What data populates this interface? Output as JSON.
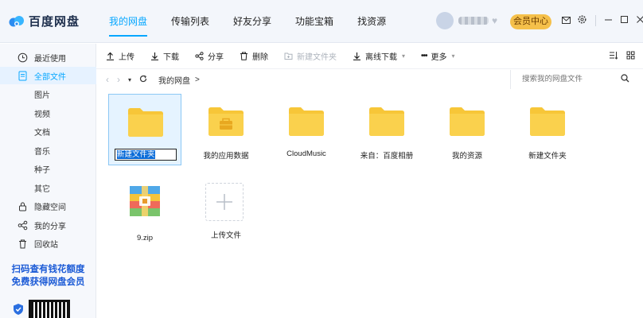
{
  "app": {
    "logo_text": "百度网盘"
  },
  "nav": {
    "tabs": [
      "我的网盘",
      "传输列表",
      "好友分享",
      "功能宝箱",
      "找资源"
    ]
  },
  "header": {
    "vip_label": "会员中心"
  },
  "sidebar": {
    "items": [
      {
        "label": "最近使用"
      },
      {
        "label": "全部文件"
      },
      {
        "label": "图片"
      },
      {
        "label": "视频"
      },
      {
        "label": "文档"
      },
      {
        "label": "音乐"
      },
      {
        "label": "种子"
      },
      {
        "label": "其它"
      },
      {
        "label": "隐藏空间"
      },
      {
        "label": "我的分享"
      },
      {
        "label": "回收站"
      }
    ],
    "promo_line1": "扫码查有钱花额度",
    "promo_line2": "免费获得网盘会员"
  },
  "toolbar": {
    "upload": "上传",
    "download": "下载",
    "share": "分享",
    "delete": "删除",
    "new_folder": "新建文件夹",
    "offline_download": "离线下载",
    "more": "更多"
  },
  "address": {
    "breadcrumb_root": "我的网盘",
    "crumb_separator": ">",
    "search_placeholder": "搜索我的网盘文件"
  },
  "files": [
    {
      "name": "新建文件夹",
      "type": "folder",
      "renaming": true
    },
    {
      "name": "我的应用数据",
      "type": "app-folder"
    },
    {
      "name": "CloudMusic",
      "type": "folder"
    },
    {
      "name": "来自：百度相册",
      "type": "folder"
    },
    {
      "name": "我的资源",
      "type": "folder"
    },
    {
      "name": "新建文件夹",
      "type": "folder"
    },
    {
      "name": "9.zip",
      "type": "zip"
    },
    {
      "name": "上传文件",
      "type": "upload"
    }
  ],
  "colors": {
    "accent": "#06a7ff",
    "folder": "#f7c638",
    "vip": "#f5c04a"
  }
}
